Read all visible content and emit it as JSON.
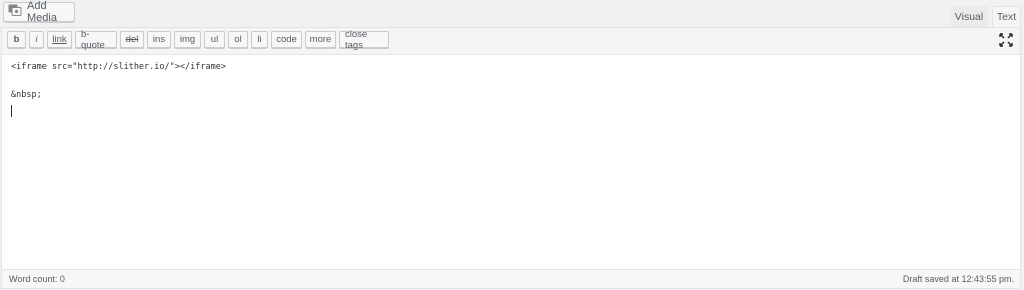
{
  "toolbar": {
    "add_media_label": "Add Media",
    "tabs": [
      "Visual",
      "Text"
    ],
    "active_tab": "Text"
  },
  "quicktags": [
    "b",
    "i",
    "link",
    "b-quote",
    "del",
    "ins",
    "img",
    "ul",
    "ol",
    "li",
    "code",
    "more",
    "close tags"
  ],
  "editor": {
    "lines": [
      "<iframe src=\"http://slither.io/\"></iframe>",
      "",
      "&nbsp;"
    ]
  },
  "status": {
    "word_count": "Word count: 0",
    "draft_saved": "Draft saved at 12:43:55 pm."
  },
  "icons": {
    "add_media": "media-icon",
    "fullscreen": "fullscreen-icon"
  }
}
